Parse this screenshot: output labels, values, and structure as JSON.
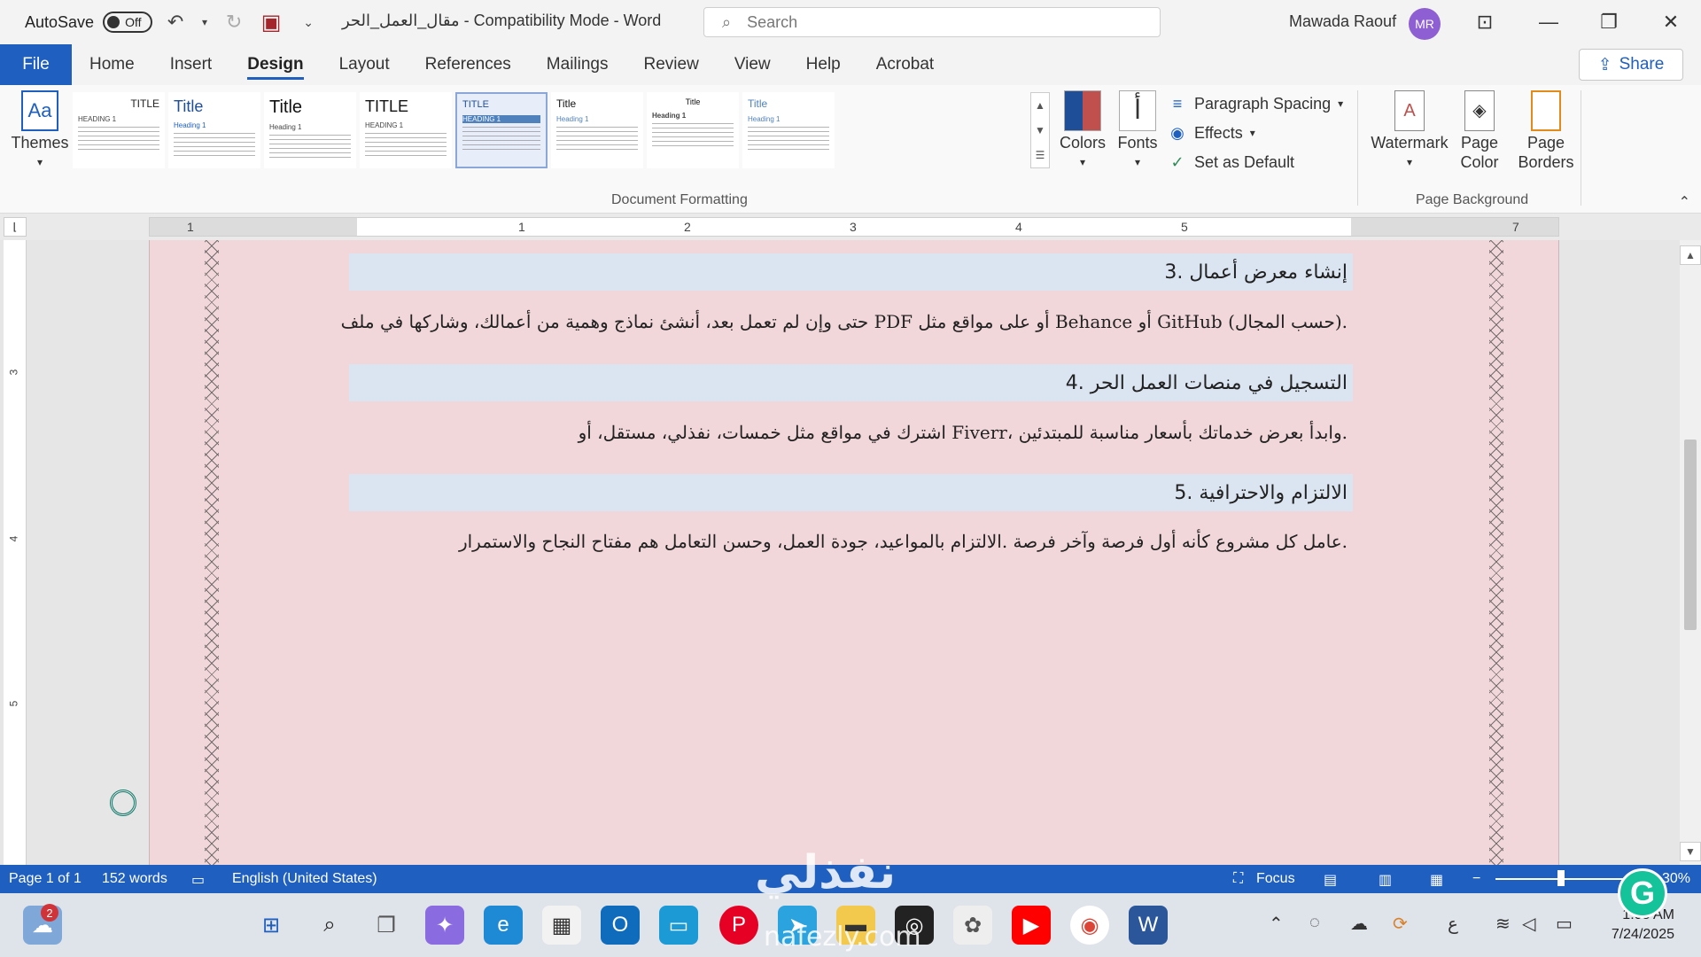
{
  "titlebar": {
    "autosave_label": "AutoSave",
    "autosave_state": "Off",
    "doc_title": "مقال_العمل_الحر  -  Compatibility Mode  -  Word",
    "search_placeholder": "Search",
    "user_name": "Mawada Raouf",
    "user_initials": "MR"
  },
  "tabs": [
    "File",
    "Home",
    "Insert",
    "Design",
    "Layout",
    "References",
    "Mailings",
    "Review",
    "View",
    "Help",
    "Acrobat"
  ],
  "active_tab": "Design",
  "share_label": "Share",
  "ribbon": {
    "themes_label": "Themes",
    "style_thumbs": [
      {
        "title": "TITLE",
        "heading": "HEADING 1"
      },
      {
        "title": "Title",
        "heading": "Heading 1"
      },
      {
        "title": "Title",
        "heading": "Heading 1"
      },
      {
        "title": "TITLE",
        "heading": "HEADING 1"
      },
      {
        "title": "TITLE",
        "heading": "HEADING 1"
      },
      {
        "title": "Title",
        "heading": "Heading 1"
      },
      {
        "title": "Title",
        "heading": "Heading 1"
      },
      {
        "title": "Title",
        "heading": "Heading 1"
      }
    ],
    "colors_label": "Colors",
    "fonts_label": "Fonts",
    "paragraph_spacing_label": "Paragraph Spacing",
    "effects_label": "Effects",
    "set_default_label": "Set as Default",
    "group_document_formatting": "Document Formatting",
    "watermark_label": "Watermark",
    "page_color_label": "Page Color",
    "page_borders_label": "Page Borders",
    "group_page_background": "Page Background"
  },
  "ruler": {
    "numbers": [
      "1",
      "1",
      "2",
      "3",
      "4",
      "5",
      "7"
    ],
    "vertical_numbers": [
      "3",
      "4",
      "5"
    ]
  },
  "document": {
    "blocks": [
      {
        "heading": "إنشاء معرض أعمال .3",
        "body": ".(حسب المجال) GitHub أو Behance أو على مواقع مثل PDF حتى وإن لم تعمل بعد، أنشئ نماذج وهمية من أعمالك، وشاركها في ملف"
      },
      {
        "heading": "التسجيل في منصات العمل الحر .4",
        "body": ".وابدأ بعرض خدماتك بأسعار مناسبة للمبتدئين ،Fiverr اشترك في مواقع مثل خمسات، نفذلي، مستقل، أو"
      },
      {
        "heading": "الالتزام والاحترافية .5",
        "body": ".عامل كل مشروع كأنه أول فرصة وآخر فرصة .الالتزام بالمواعيد، جودة العمل، وحسن التعامل هم مفتاح النجاح والاستمرار"
      }
    ]
  },
  "statusbar": {
    "page": "Page 1 of 1",
    "words": "152 words",
    "language": "English (United States)",
    "focus": "Focus",
    "zoom": "30%"
  },
  "taskbar": {
    "notification_count": "2",
    "time": "1:08 AM",
    "date": "7/24/2025",
    "lang": "ع"
  },
  "watermark": {
    "logo": "نفذلي",
    "url": "nafezly.com"
  }
}
